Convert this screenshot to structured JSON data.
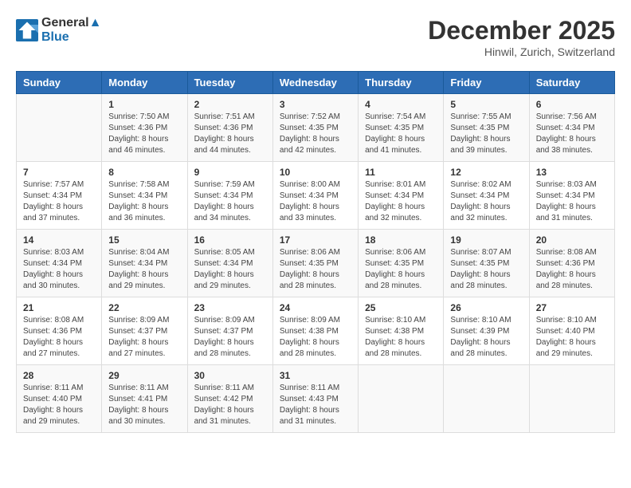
{
  "logo": {
    "line1": "General",
    "line2": "Blue"
  },
  "title": "December 2025",
  "location": "Hinwil, Zurich, Switzerland",
  "weekdays": [
    "Sunday",
    "Monday",
    "Tuesday",
    "Wednesday",
    "Thursday",
    "Friday",
    "Saturday"
  ],
  "weeks": [
    [
      {
        "day": "",
        "sunrise": "",
        "sunset": "",
        "daylight": ""
      },
      {
        "day": "1",
        "sunrise": "Sunrise: 7:50 AM",
        "sunset": "Sunset: 4:36 PM",
        "daylight": "Daylight: 8 hours and 46 minutes."
      },
      {
        "day": "2",
        "sunrise": "Sunrise: 7:51 AM",
        "sunset": "Sunset: 4:36 PM",
        "daylight": "Daylight: 8 hours and 44 minutes."
      },
      {
        "day": "3",
        "sunrise": "Sunrise: 7:52 AM",
        "sunset": "Sunset: 4:35 PM",
        "daylight": "Daylight: 8 hours and 42 minutes."
      },
      {
        "day": "4",
        "sunrise": "Sunrise: 7:54 AM",
        "sunset": "Sunset: 4:35 PM",
        "daylight": "Daylight: 8 hours and 41 minutes."
      },
      {
        "day": "5",
        "sunrise": "Sunrise: 7:55 AM",
        "sunset": "Sunset: 4:35 PM",
        "daylight": "Daylight: 8 hours and 39 minutes."
      },
      {
        "day": "6",
        "sunrise": "Sunrise: 7:56 AM",
        "sunset": "Sunset: 4:34 PM",
        "daylight": "Daylight: 8 hours and 38 minutes."
      }
    ],
    [
      {
        "day": "7",
        "sunrise": "Sunrise: 7:57 AM",
        "sunset": "Sunset: 4:34 PM",
        "daylight": "Daylight: 8 hours and 37 minutes."
      },
      {
        "day": "8",
        "sunrise": "Sunrise: 7:58 AM",
        "sunset": "Sunset: 4:34 PM",
        "daylight": "Daylight: 8 hours and 36 minutes."
      },
      {
        "day": "9",
        "sunrise": "Sunrise: 7:59 AM",
        "sunset": "Sunset: 4:34 PM",
        "daylight": "Daylight: 8 hours and 34 minutes."
      },
      {
        "day": "10",
        "sunrise": "Sunrise: 8:00 AM",
        "sunset": "Sunset: 4:34 PM",
        "daylight": "Daylight: 8 hours and 33 minutes."
      },
      {
        "day": "11",
        "sunrise": "Sunrise: 8:01 AM",
        "sunset": "Sunset: 4:34 PM",
        "daylight": "Daylight: 8 hours and 32 minutes."
      },
      {
        "day": "12",
        "sunrise": "Sunrise: 8:02 AM",
        "sunset": "Sunset: 4:34 PM",
        "daylight": "Daylight: 8 hours and 32 minutes."
      },
      {
        "day": "13",
        "sunrise": "Sunrise: 8:03 AM",
        "sunset": "Sunset: 4:34 PM",
        "daylight": "Daylight: 8 hours and 31 minutes."
      }
    ],
    [
      {
        "day": "14",
        "sunrise": "Sunrise: 8:03 AM",
        "sunset": "Sunset: 4:34 PM",
        "daylight": "Daylight: 8 hours and 30 minutes."
      },
      {
        "day": "15",
        "sunrise": "Sunrise: 8:04 AM",
        "sunset": "Sunset: 4:34 PM",
        "daylight": "Daylight: 8 hours and 29 minutes."
      },
      {
        "day": "16",
        "sunrise": "Sunrise: 8:05 AM",
        "sunset": "Sunset: 4:34 PM",
        "daylight": "Daylight: 8 hours and 29 minutes."
      },
      {
        "day": "17",
        "sunrise": "Sunrise: 8:06 AM",
        "sunset": "Sunset: 4:35 PM",
        "daylight": "Daylight: 8 hours and 28 minutes."
      },
      {
        "day": "18",
        "sunrise": "Sunrise: 8:06 AM",
        "sunset": "Sunset: 4:35 PM",
        "daylight": "Daylight: 8 hours and 28 minutes."
      },
      {
        "day": "19",
        "sunrise": "Sunrise: 8:07 AM",
        "sunset": "Sunset: 4:35 PM",
        "daylight": "Daylight: 8 hours and 28 minutes."
      },
      {
        "day": "20",
        "sunrise": "Sunrise: 8:08 AM",
        "sunset": "Sunset: 4:36 PM",
        "daylight": "Daylight: 8 hours and 28 minutes."
      }
    ],
    [
      {
        "day": "21",
        "sunrise": "Sunrise: 8:08 AM",
        "sunset": "Sunset: 4:36 PM",
        "daylight": "Daylight: 8 hours and 27 minutes."
      },
      {
        "day": "22",
        "sunrise": "Sunrise: 8:09 AM",
        "sunset": "Sunset: 4:37 PM",
        "daylight": "Daylight: 8 hours and 27 minutes."
      },
      {
        "day": "23",
        "sunrise": "Sunrise: 8:09 AM",
        "sunset": "Sunset: 4:37 PM",
        "daylight": "Daylight: 8 hours and 28 minutes."
      },
      {
        "day": "24",
        "sunrise": "Sunrise: 8:09 AM",
        "sunset": "Sunset: 4:38 PM",
        "daylight": "Daylight: 8 hours and 28 minutes."
      },
      {
        "day": "25",
        "sunrise": "Sunrise: 8:10 AM",
        "sunset": "Sunset: 4:38 PM",
        "daylight": "Daylight: 8 hours and 28 minutes."
      },
      {
        "day": "26",
        "sunrise": "Sunrise: 8:10 AM",
        "sunset": "Sunset: 4:39 PM",
        "daylight": "Daylight: 8 hours and 28 minutes."
      },
      {
        "day": "27",
        "sunrise": "Sunrise: 8:10 AM",
        "sunset": "Sunset: 4:40 PM",
        "daylight": "Daylight: 8 hours and 29 minutes."
      }
    ],
    [
      {
        "day": "28",
        "sunrise": "Sunrise: 8:11 AM",
        "sunset": "Sunset: 4:40 PM",
        "daylight": "Daylight: 8 hours and 29 minutes."
      },
      {
        "day": "29",
        "sunrise": "Sunrise: 8:11 AM",
        "sunset": "Sunset: 4:41 PM",
        "daylight": "Daylight: 8 hours and 30 minutes."
      },
      {
        "day": "30",
        "sunrise": "Sunrise: 8:11 AM",
        "sunset": "Sunset: 4:42 PM",
        "daylight": "Daylight: 8 hours and 31 minutes."
      },
      {
        "day": "31",
        "sunrise": "Sunrise: 8:11 AM",
        "sunset": "Sunset: 4:43 PM",
        "daylight": "Daylight: 8 hours and 31 minutes."
      },
      {
        "day": "",
        "sunrise": "",
        "sunset": "",
        "daylight": ""
      },
      {
        "day": "",
        "sunrise": "",
        "sunset": "",
        "daylight": ""
      },
      {
        "day": "",
        "sunrise": "",
        "sunset": "",
        "daylight": ""
      }
    ]
  ]
}
